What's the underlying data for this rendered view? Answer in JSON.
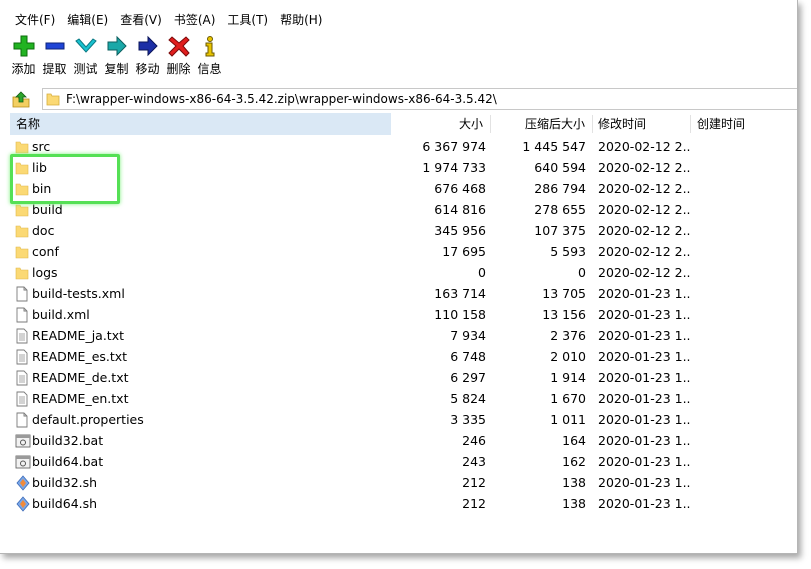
{
  "menu": [
    {
      "label": "文件(F)"
    },
    {
      "label": "编辑(E)"
    },
    {
      "label": "查看(V)"
    },
    {
      "label": "书签(A)"
    },
    {
      "label": "工具(T)"
    },
    {
      "label": "帮助(H)"
    }
  ],
  "toolbar": [
    {
      "label": "添加",
      "icon": "plus-icon",
      "color": "#1fa01f"
    },
    {
      "label": "提取",
      "icon": "minus-icon",
      "color": "#1b3fc8"
    },
    {
      "label": "测试",
      "icon": "checkmark-icon",
      "color": "#17b8c8"
    },
    {
      "label": "复制",
      "icon": "copy-arrow-icon",
      "color": "#1aa3a3"
    },
    {
      "label": "移动",
      "icon": "move-arrow-icon",
      "color": "#1b2f9e"
    },
    {
      "label": "删除",
      "icon": "delete-x-icon",
      "color": "#d91c1c"
    },
    {
      "label": "信息",
      "icon": "info-icon",
      "color": "#e0c000"
    }
  ],
  "address": {
    "path": "F:\\wrapper-windows-x86-64-3.5.42.zip\\wrapper-windows-x86-64-3.5.42\\"
  },
  "columns": {
    "name": "名称",
    "size": "大小",
    "packed": "压缩后大小",
    "modified": "修改时间",
    "created": "创建时间"
  },
  "files": [
    {
      "name": "src",
      "size": "6 367 974",
      "packed": "1 445 547",
      "modified": "2020-02-12 2...",
      "icon": "folder-icon"
    },
    {
      "name": "lib",
      "size": "1 974 733",
      "packed": "640 594",
      "modified": "2020-02-12 2...",
      "icon": "folder-icon"
    },
    {
      "name": "bin",
      "size": "676 468",
      "packed": "286 794",
      "modified": "2020-02-12 2...",
      "icon": "folder-icon"
    },
    {
      "name": "build",
      "size": "614 816",
      "packed": "278 655",
      "modified": "2020-02-12 2...",
      "icon": "folder-icon"
    },
    {
      "name": "doc",
      "size": "345 956",
      "packed": "107 375",
      "modified": "2020-02-12 2...",
      "icon": "folder-icon"
    },
    {
      "name": "conf",
      "size": "17 695",
      "packed": "5 593",
      "modified": "2020-02-12 2...",
      "icon": "folder-icon"
    },
    {
      "name": "logs",
      "size": "0",
      "packed": "0",
      "modified": "2020-02-12 2...",
      "icon": "folder-icon"
    },
    {
      "name": "build-tests.xml",
      "size": "163 714",
      "packed": "13 705",
      "modified": "2020-01-23 1...",
      "icon": "file-icon"
    },
    {
      "name": "build.xml",
      "size": "110 158",
      "packed": "13 156",
      "modified": "2020-01-23 1...",
      "icon": "file-icon"
    },
    {
      "name": "README_ja.txt",
      "size": "7 934",
      "packed": "2 376",
      "modified": "2020-01-23 1...",
      "icon": "text-file-icon"
    },
    {
      "name": "README_es.txt",
      "size": "6 748",
      "packed": "2 010",
      "modified": "2020-01-23 1...",
      "icon": "text-file-icon"
    },
    {
      "name": "README_de.txt",
      "size": "6 297",
      "packed": "1 914",
      "modified": "2020-01-23 1...",
      "icon": "text-file-icon"
    },
    {
      "name": "README_en.txt",
      "size": "5 824",
      "packed": "1 670",
      "modified": "2020-01-23 1...",
      "icon": "text-file-icon"
    },
    {
      "name": "default.properties",
      "size": "3 335",
      "packed": "1 011",
      "modified": "2020-01-23 1...",
      "icon": "file-icon"
    },
    {
      "name": "build32.bat",
      "size": "246",
      "packed": "164",
      "modified": "2020-01-23 1...",
      "icon": "bat-file-icon"
    },
    {
      "name": "build64.bat",
      "size": "243",
      "packed": "162",
      "modified": "2020-01-23 1...",
      "icon": "bat-file-icon"
    },
    {
      "name": "build32.sh",
      "size": "212",
      "packed": "138",
      "modified": "2020-01-23 1...",
      "icon": "shell-script-icon"
    },
    {
      "name": "build64.sh",
      "size": "212",
      "packed": "138",
      "modified": "2020-01-23 1...",
      "icon": "shell-script-icon"
    }
  ],
  "highlight_color": "#55e055"
}
